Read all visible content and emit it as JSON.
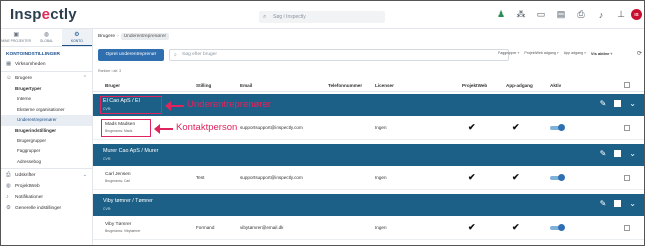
{
  "app": {
    "logo_text_a": "Insp",
    "logo_text_b": "e",
    "logo_text_c": "ctly",
    "search_placeholder": "Søg i Inspectly",
    "avatar_initials": "IS"
  },
  "sidebar": {
    "tabs": [
      {
        "label": "MINE PROJEKTER",
        "icon": "briefcase-icon"
      },
      {
        "label": "GLOBAL",
        "icon": "globe-icon"
      },
      {
        "label": "KONTO",
        "icon": "gear-icon"
      }
    ],
    "section_title": "KONTOINDSTILLINGER",
    "items": {
      "virksomheden": "Virksomheden",
      "brugere": "Brugere",
      "brugertyper": "Brugertyper",
      "interne": "Interne",
      "eksterne": "Eksterne organisationer",
      "underentreprenorer": "Underentreprenører",
      "brugerindstillinger": "Brugerindstillinger",
      "brugergrupper": "Brugergrupper",
      "faggrupper": "Faggrupper",
      "adressebog": "Adressebog",
      "udskrifter": "Udskrifter",
      "projektweb": "ProjektWeb",
      "notifikationer": "Notifikationer",
      "generelle": "Generelle indstillinger"
    }
  },
  "main": {
    "breadcrumb_root": "Brugere",
    "breadcrumb_current": "Underentreprenører",
    "create_button": "Opret underentreprenør",
    "search_placeholder": "Søg efter bruger",
    "filters": [
      "Faggrupper",
      "ProjektWeb adgang",
      "App adgang"
    ],
    "visible_filter": "Vis aktive",
    "row_count": "Rækker i alt: 3",
    "columns": {
      "bruger": "Bruger",
      "stilling": "Stilling",
      "email": "Email",
      "telefon": "Telefonnummer",
      "licenser": "Licenser",
      "projektweb": "ProjektWeb",
      "app": "App-adgang",
      "aktiv": "Aktiv"
    },
    "groups": [
      {
        "name": "El Cao ApS / El",
        "cvr": "CVR:",
        "contact": {
          "name": "Mads Madsen",
          "role": "Brugeransv. Mads",
          "stilling": "",
          "email": "supportsupport@inspectly.com",
          "licens": "Ingen",
          "projektweb": true,
          "app": true,
          "aktiv": true
        }
      },
      {
        "name": "Murer Cao ApS / Murer",
        "cvr": "CVR:",
        "contact": {
          "name": "Carl Jensen",
          "role": "Brugeransv. Carl",
          "stilling": "Test",
          "email": "supportsupport@inspectly.com",
          "licens": "Ingen",
          "projektweb": true,
          "app": true,
          "aktiv": true
        }
      },
      {
        "name": "Viby tømrer / Tømrer",
        "cvr": "CVR:",
        "contact": {
          "name": "Viby Tømrer",
          "role": "Brugeransv. Vibytømrer",
          "stilling": "Formand",
          "email": "vibytømrer@email.dk",
          "licens": "Ingen",
          "projektweb": true,
          "app": true,
          "aktiv": true
        }
      }
    ]
  },
  "annotations": {
    "subcontractor": "Underentreprenører",
    "contact": "Kontaktperson"
  },
  "colors": {
    "group_header": "#1c6087",
    "primary_button": "#2f6fb0",
    "annotation": "#e0245e",
    "logo_accent": "#e02b5a"
  },
  "check_glyph": "✔"
}
